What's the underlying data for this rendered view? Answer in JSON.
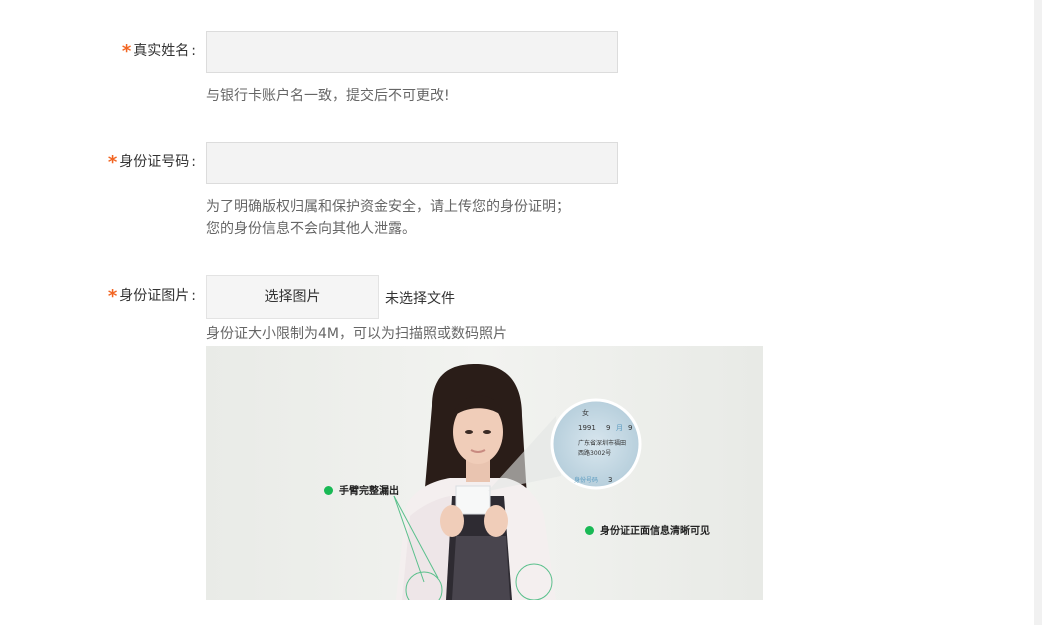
{
  "form": {
    "required_mark": "*",
    "colon": ":",
    "name": {
      "label": "真实姓名",
      "value": "",
      "placeholder": "",
      "hint": "与银行卡账户名一致，提交后不可更改!"
    },
    "id_number": {
      "label": "身份证号码",
      "value": "",
      "placeholder": "",
      "hint_line1": "为了明确版权归属和保护资金安全，请上传您的身份证明；",
      "hint_line2": "您的身份信息不会向其他人泄露。"
    },
    "id_image": {
      "label": "身份证图片",
      "button_label": "选择图片",
      "file_status": "未选择文件",
      "hint": "身份证大小限制为4M，可以为扫描照或数码照片"
    }
  },
  "example_image": {
    "callout_arms": "手臂完整漏出",
    "callout_front": "身份证正面信息清晰可见",
    "card_text": {
      "gender": "女",
      "year": "1991",
      "month_num": "9",
      "month_unit": "月",
      "day": "9",
      "address1": "广东省深圳市福田",
      "address2": "西路3002号",
      "id_label": "身份号码",
      "id_partial": "3"
    },
    "accent_color": "#19b955"
  },
  "colors": {
    "required_star": "#f26522",
    "input_bg": "#f3f3f3",
    "hint_text": "#666666"
  }
}
